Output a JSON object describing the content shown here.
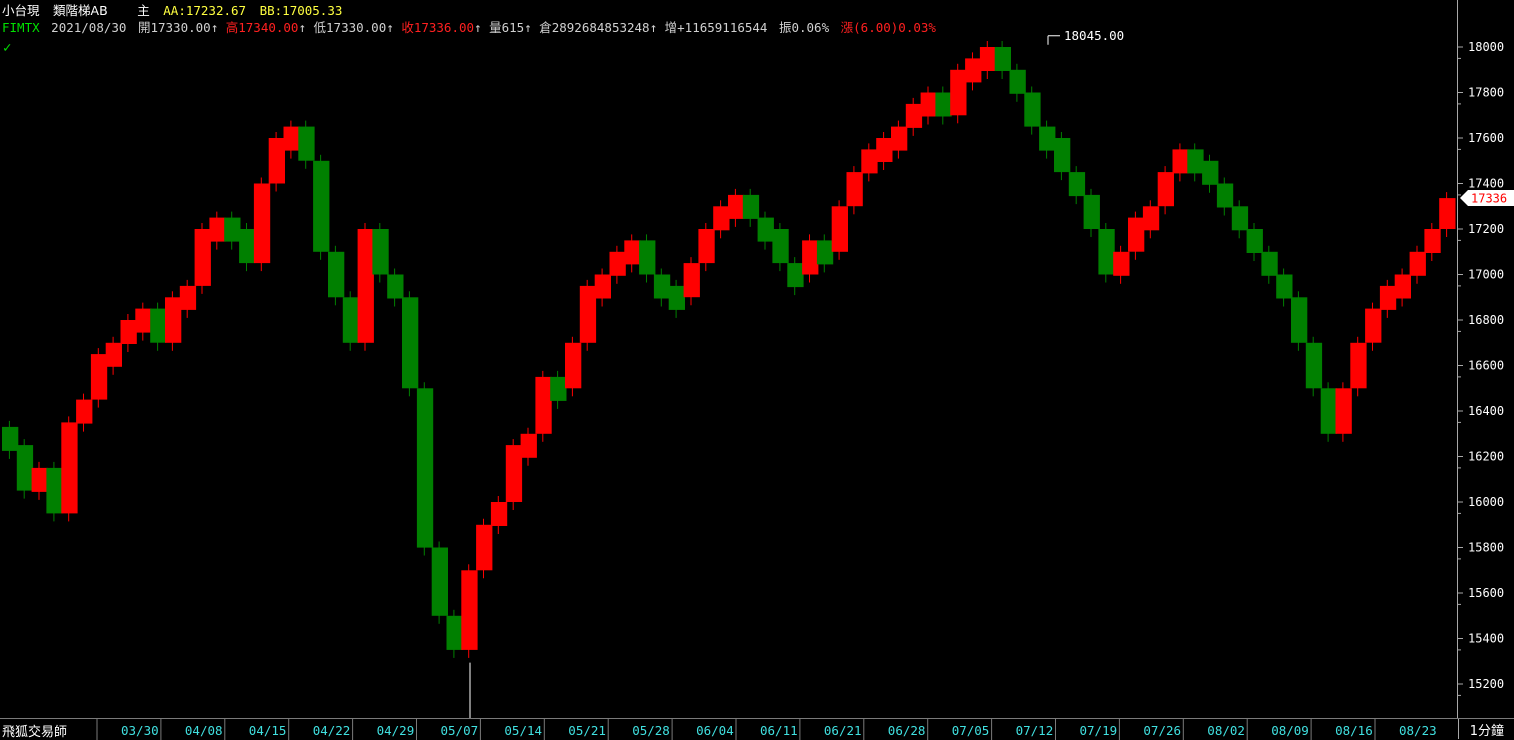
{
  "header": {
    "line1": {
      "symbol": "小台現",
      "indicator": "類階梯AB",
      "main_label": "主",
      "aa": "AA:17232.67",
      "bb": "BB:17005.33"
    },
    "line2": {
      "code": "FIMTX",
      "date": "2021/08/30",
      "open": "開17330.00",
      "high": "高17340.00",
      "low": "低17330.00",
      "close": "收17336.00",
      "volume": "量615",
      "open_interest": "倉2892684853248",
      "oi_change": "增+11659116544",
      "amplitude": "振0.06%",
      "change": "漲(6.00)0.03%",
      "arrow": "↑"
    }
  },
  "colors": {
    "background": "#000000",
    "up": "#ff0000",
    "down": "#008000",
    "axis_text": "#ffffff",
    "date_text": "#40e0e0",
    "last_price_label": "#ff0000"
  },
  "footer": {
    "brand": "飛狐交易師",
    "period": "1分鐘"
  },
  "chart_data": {
    "type": "bar",
    "style": "step-ladder",
    "ylim": [
      15030,
      18045
    ],
    "y_ticks": [
      15200,
      15400,
      15600,
      15800,
      16000,
      16200,
      16400,
      16600,
      16800,
      17000,
      17200,
      17400,
      17600,
      17800,
      18000
    ],
    "x_labels": [
      "03/30",
      "04/08",
      "04/15",
      "04/22",
      "04/29",
      "05/07",
      "05/14",
      "05/21",
      "05/28",
      "06/04",
      "06/11",
      "06/21",
      "06/28",
      "07/05",
      "07/12",
      "07/19",
      "07/26",
      "08/02",
      "08/09",
      "08/16",
      "08/23"
    ],
    "annotations": {
      "max": "18045.00",
      "min": "15030.00",
      "last": "17336"
    },
    "path": [
      [
        "03/24",
        16250
      ],
      [
        "03/25",
        16050
      ],
      [
        "03/26",
        16150
      ],
      [
        "03/29",
        15950
      ],
      [
        "03/30",
        16350
      ],
      [
        "03/31",
        16450
      ],
      [
        "04/01",
        16650
      ],
      [
        "04/06",
        16700
      ],
      [
        "04/07",
        16800
      ],
      [
        "04/08",
        16850
      ],
      [
        "04/09",
        16700
      ],
      [
        "04/12",
        16900
      ],
      [
        "04/13",
        16950
      ],
      [
        "04/14",
        17200
      ],
      [
        "04/15",
        17250
      ],
      [
        "04/16",
        17200
      ],
      [
        "04/19",
        17050
      ],
      [
        "04/20",
        17400
      ],
      [
        "04/21",
        17600
      ],
      [
        "04/22",
        17650
      ],
      [
        "04/23",
        17500
      ],
      [
        "04/26",
        17100
      ],
      [
        "04/27",
        16900
      ],
      [
        "04/28",
        16700
      ],
      [
        "04/29",
        17200
      ],
      [
        "04/30",
        17000
      ],
      [
        "05/03",
        16900
      ],
      [
        "05/04",
        16500
      ],
      [
        "05/05",
        15800
      ],
      [
        "05/06",
        15500
      ],
      [
        "05/07",
        15350
      ],
      [
        "05/10",
        15700
      ],
      [
        "05/11",
        15900
      ],
      [
        "05/12",
        16000
      ],
      [
        "05/13",
        16250
      ],
      [
        "05/14",
        16300
      ],
      [
        "05/17",
        16550
      ],
      [
        "05/18",
        16500
      ],
      [
        "05/19",
        16700
      ],
      [
        "05/20",
        16950
      ],
      [
        "05/21",
        17000
      ],
      [
        "05/24",
        17100
      ],
      [
        "05/25",
        17150
      ],
      [
        "05/26",
        17000
      ],
      [
        "05/27",
        16950
      ],
      [
        "05/28",
        16900
      ],
      [
        "05/31",
        17050
      ],
      [
        "06/01",
        17200
      ],
      [
        "06/02",
        17300
      ],
      [
        "06/03",
        17350
      ],
      [
        "06/04",
        17250
      ],
      [
        "06/07",
        17200
      ],
      [
        "06/08",
        17050
      ],
      [
        "06/09",
        17000
      ],
      [
        "06/10",
        17150
      ],
      [
        "06/11",
        17100
      ],
      [
        "06/15",
        17300
      ],
      [
        "06/16",
        17450
      ],
      [
        "06/17",
        17550
      ],
      [
        "06/18",
        17600
      ],
      [
        "06/21",
        17650
      ],
      [
        "06/22",
        17750
      ],
      [
        "06/23",
        17800
      ],
      [
        "06/24",
        17700
      ],
      [
        "06/25",
        17900
      ],
      [
        "06/28",
        17950
      ],
      [
        "06/29",
        18000
      ],
      [
        "06/30",
        17900
      ],
      [
        "07/01",
        17800
      ],
      [
        "07/02",
        17650
      ],
      [
        "07/05",
        17600
      ],
      [
        "07/06",
        17450
      ],
      [
        "07/07",
        17350
      ],
      [
        "07/08",
        17200
      ],
      [
        "07/09",
        17000
      ],
      [
        "07/12",
        17100
      ],
      [
        "07/13",
        17250
      ],
      [
        "07/14",
        17300
      ],
      [
        "07/15",
        17450
      ],
      [
        "07/16",
        17550
      ],
      [
        "07/19",
        17500
      ],
      [
        "07/20",
        17400
      ],
      [
        "07/21",
        17300
      ],
      [
        "07/22",
        17200
      ],
      [
        "07/23",
        17100
      ],
      [
        "07/26",
        17000
      ],
      [
        "07/27",
        16900
      ],
      [
        "07/28",
        16700
      ],
      [
        "07/29",
        16500
      ],
      [
        "07/30",
        16300
      ],
      [
        "08/02",
        16500
      ],
      [
        "08/03",
        16700
      ],
      [
        "08/04",
        16850
      ],
      [
        "08/05",
        16950
      ],
      [
        "08/06",
        17000
      ],
      [
        "08/09",
        17100
      ],
      [
        "08/10",
        17200
      ],
      [
        "08/11",
        17336
      ]
    ]
  }
}
